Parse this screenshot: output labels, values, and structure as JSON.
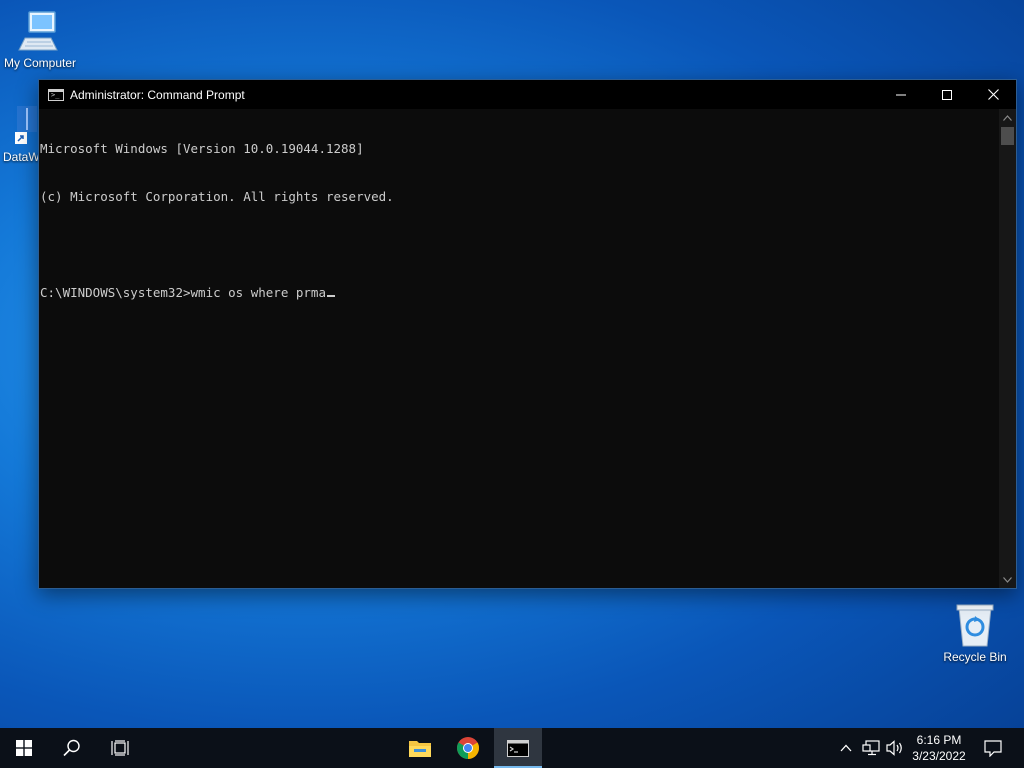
{
  "desktop": {
    "icons": [
      {
        "label": "My Computer",
        "icon": "computer-icon"
      },
      {
        "label": "DataW",
        "icon": "app-shortcut-icon"
      },
      {
        "label": "Recycle Bin",
        "icon": "recycle-bin-icon"
      }
    ]
  },
  "window": {
    "title": "Administrator: Command Prompt",
    "icon": "cmd-icon",
    "controls": [
      "minimize-icon",
      "maximize-icon",
      "close-icon"
    ]
  },
  "console": {
    "lines": [
      "Microsoft Windows [Version 10.0.19044.1288]",
      "(c) Microsoft Corporation. All rights reserved.",
      "",
      "C:\\WINDOWS\\system32>wmic os where prma"
    ]
  },
  "taskbar": {
    "left_buttons": [
      "windows-start-icon",
      "search-icon",
      "task-view-icon"
    ],
    "pinned": [
      "file-explorer-icon",
      "chrome-icon",
      "cmd-icon"
    ],
    "active": "cmd-icon",
    "tray": [
      "chevron-up-icon",
      "network-icon",
      "volume-icon"
    ],
    "time": "6:16 PM",
    "date": "3/23/2022",
    "notification_icon": "notification-icon"
  },
  "colors": {
    "console_bg": "#0c0c0c",
    "console_text": "#cccccc",
    "titlebar_bg": "#000000",
    "taskbar_bg": "#0b1018",
    "accent": "#76b9ed"
  }
}
